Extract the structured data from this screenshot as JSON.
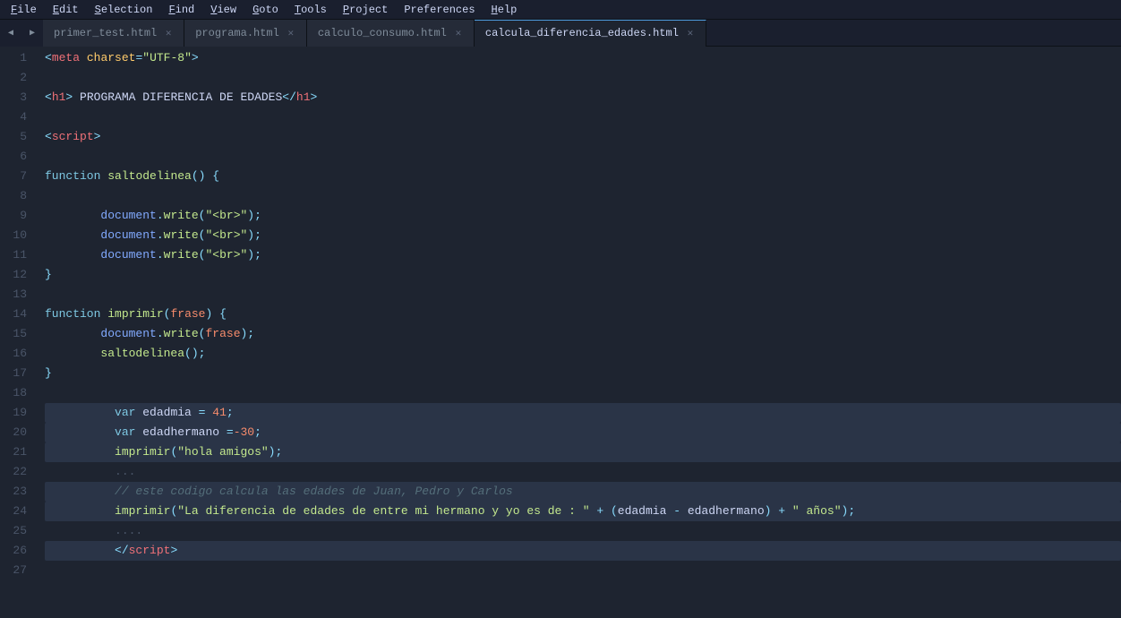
{
  "menu": {
    "items": [
      "File",
      "Edit",
      "Selection",
      "Find",
      "View",
      "Goto",
      "Tools",
      "Project",
      "Preferences",
      "Help"
    ]
  },
  "tabs": [
    {
      "label": "primer_test.html",
      "active": false
    },
    {
      "label": "programa.html",
      "active": false
    },
    {
      "label": "calculo_consumo.html",
      "active": false
    },
    {
      "label": "calcula_diferencia_edades.html",
      "active": true
    }
  ],
  "lines": [
    {
      "num": 1
    },
    {
      "num": 2
    },
    {
      "num": 3
    },
    {
      "num": 4
    },
    {
      "num": 5
    },
    {
      "num": 6
    },
    {
      "num": 7
    },
    {
      "num": 8
    },
    {
      "num": 9
    },
    {
      "num": 10
    },
    {
      "num": 11
    },
    {
      "num": 12
    },
    {
      "num": 13
    },
    {
      "num": 14
    },
    {
      "num": 15
    },
    {
      "num": 16
    },
    {
      "num": 17
    },
    {
      "num": 18
    },
    {
      "num": 19
    },
    {
      "num": 20
    },
    {
      "num": 21
    },
    {
      "num": 22
    },
    {
      "num": 23
    },
    {
      "num": 24
    },
    {
      "num": 25
    },
    {
      "num": 26
    },
    {
      "num": 27
    }
  ]
}
